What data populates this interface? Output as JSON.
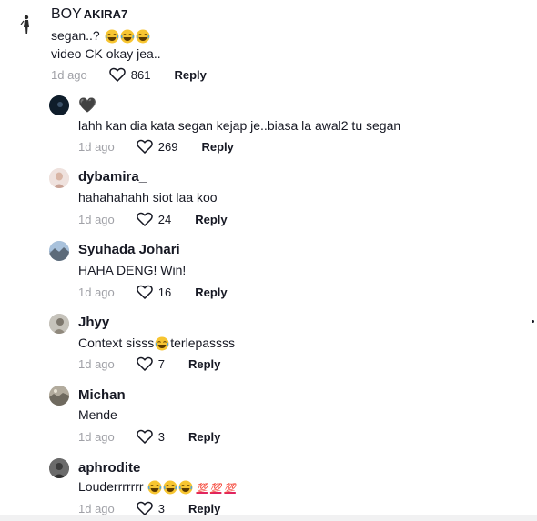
{
  "comments": [
    {
      "username_prefix": "BOY",
      "username_suffix": "AKIRA7",
      "text_lines": [
        "segan..?",
        "video CK okay jea.."
      ],
      "emojis_line1": [
        "laugh",
        "laugh",
        "laugh"
      ],
      "date": "1d ago",
      "likes": "861",
      "reply": "Reply"
    },
    {
      "username": "🖤",
      "text": "lahh kan dia kata segan kejap je..biasa la awal2 tu segan",
      "date": "1d ago",
      "likes": "269",
      "reply": "Reply"
    },
    {
      "username": "dybamira_",
      "text": "hahahahahh siot laa koo",
      "date": "1d ago",
      "likes": "24",
      "reply": "Reply"
    },
    {
      "username": "Syuhada Johari",
      "text": "HAHA DENG! Win!",
      "date": "1d ago",
      "likes": "16",
      "reply": "Reply"
    },
    {
      "username": "Jhyy",
      "text_before": "Context sisss",
      "text_after": "terlepassss",
      "date": "1d ago",
      "likes": "7",
      "reply": "Reply"
    },
    {
      "username": "Michan",
      "text": "Mende",
      "date": "1d ago",
      "likes": "3",
      "reply": "Reply"
    },
    {
      "username": "aphrodite",
      "text": "Louderrrrrrr",
      "hundred": [
        "💯",
        "💯",
        "💯"
      ],
      "date": "1d ago",
      "likes": "3",
      "reply": "Reply"
    }
  ],
  "colors": {
    "text": "#161823",
    "muted": "#8a8b91",
    "laugh_emoji": "#f7c531"
  }
}
